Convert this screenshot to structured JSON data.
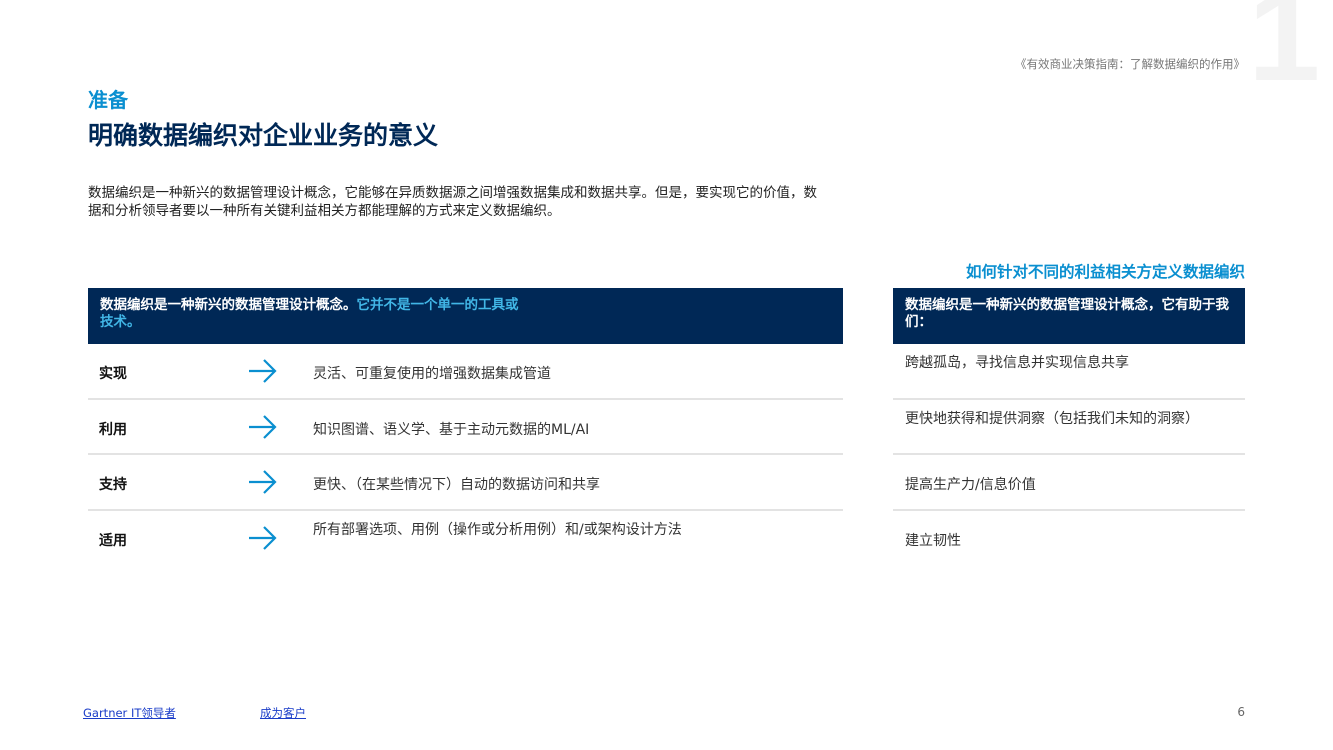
{
  "big_number": "1",
  "doc_title": "《有效商业决策指南：了解数据编织的作用》",
  "kicker": "准备",
  "title": "明确数据编织对企业业务的意义",
  "intro": "数据编织是一种新兴的数据管理设计概念，它能够在异质数据源之间增强数据集成和数据共享。但是，要实现它的价值，数据和分析领导者要以一种所有关键利益相关方都能理解的方式来定义数据编织。",
  "left": {
    "header_plain": "数据编织是一种新兴的数据管理设计概念。",
    "header_highlight": "它并不是一个单一的工具或技术。",
    "rows": [
      {
        "key": "实现",
        "value": "灵活、可重复使用的增强数据集成管道"
      },
      {
        "key": "利用",
        "value": "知识图谱、语义学、基于主动元数据的ML/AI"
      },
      {
        "key": "支持",
        "value": "更快、（在某些情况下）自动的数据访问和共享"
      },
      {
        "key": "适用",
        "value": "所有部署选项、用例（操作或分析用例）和/或架构设计方法"
      }
    ]
  },
  "right": {
    "title": "如何针对不同的利益相关方定义数据编织",
    "header": "数据编织是一种新兴的数据管理设计概念，它有助于我们：",
    "rows": [
      "跨越孤岛，寻找信息并实现信息共享",
      "更快地获得和提供洞察（包括我们未知的洞察）",
      "提高生产力/信息价值",
      "建立韧性"
    ]
  },
  "footer": {
    "link1": "Gartner IT领导者",
    "link2": "成为客户",
    "page": "6"
  },
  "colors": {
    "navy": "#002856",
    "accent": "#0a8fd0",
    "highlight": "#41b6e6"
  }
}
